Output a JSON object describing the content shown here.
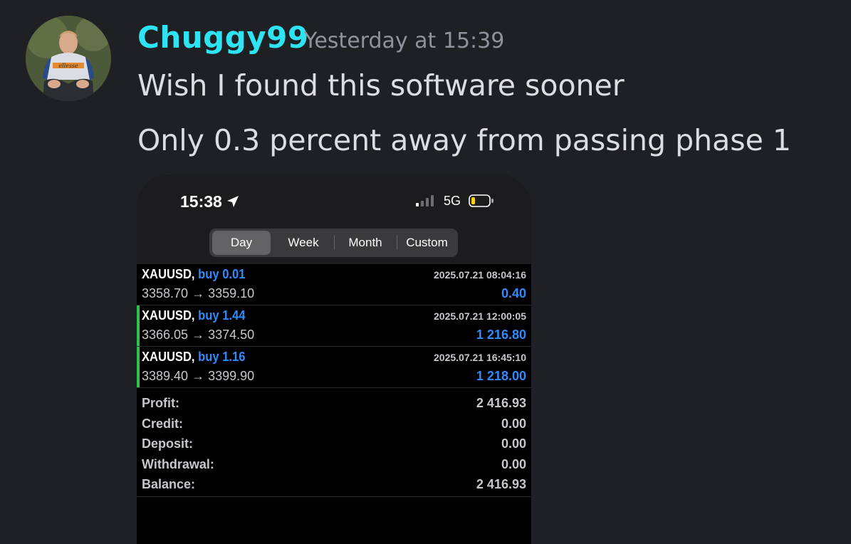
{
  "message": {
    "username": "Chuggy99",
    "timestamp": "Yesterday at 15:39",
    "lines": [
      "Wish I found this software sooner",
      "Only 0.3 percent away from passing phase 1"
    ]
  },
  "phone": {
    "status_bar": {
      "time": "15:38",
      "network": "5G"
    },
    "period_tabs": [
      "Day",
      "Week",
      "Month",
      "Custom"
    ],
    "selected_tab": "Day",
    "trades": [
      {
        "symbol": "XAUUSD,",
        "direction": "buy 0.01",
        "time": "2025.07.21 08:04:16",
        "prices": "3358.70 → 3359.10",
        "profit": "0.40"
      },
      {
        "symbol": "XAUUSD,",
        "direction": "buy 1.44",
        "time": "2025.07.21 12:00:05",
        "prices": "3366.05 → 3374.50",
        "profit": "1 216.80"
      },
      {
        "symbol": "XAUUSD,",
        "direction": "buy 1.16",
        "time": "2025.07.21 16:45:10",
        "prices": "3389.40 → 3399.90",
        "profit": "1 218.00"
      }
    ],
    "summary": [
      {
        "label": "Profit:",
        "value": "2 416.93"
      },
      {
        "label": "Credit:",
        "value": "0.00"
      },
      {
        "label": "Deposit:",
        "value": "0.00"
      },
      {
        "label": "Withdrawal:",
        "value": "0.00"
      },
      {
        "label": "Balance:",
        "value": "2 416.93"
      }
    ]
  },
  "colors": {
    "background": "#1f2024",
    "username": "#2ee3f2",
    "buy": "#2f8cff",
    "win_marker": "#2bc44a"
  }
}
